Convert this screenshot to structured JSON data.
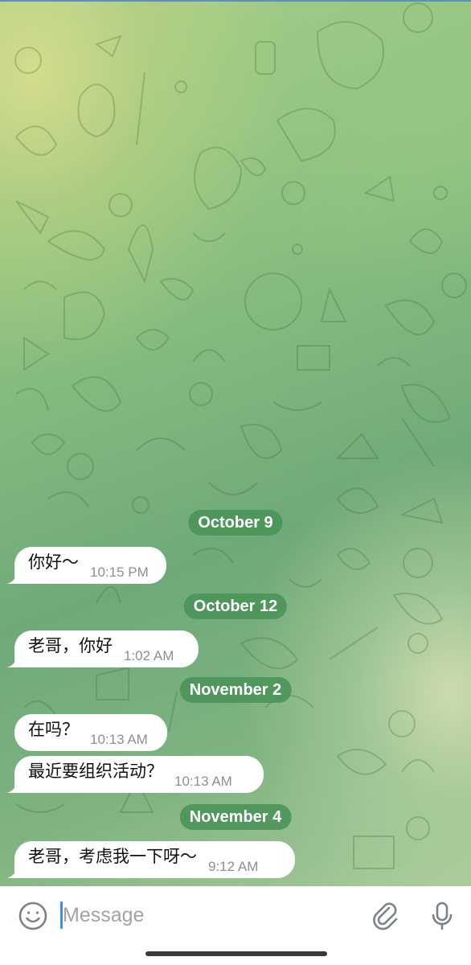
{
  "chat": {
    "dates": {
      "d1": "October 9",
      "d2": "October 12",
      "d3": "November 2",
      "d4": "November 4"
    },
    "messages": {
      "m1": {
        "text": "你好～",
        "time": "10:15 PM"
      },
      "m2": {
        "text": "老哥，你好",
        "time": "1:02 AM"
      },
      "m3": {
        "text": "在吗？",
        "time": "10:13 AM"
      },
      "m4": {
        "text": "最近要组织活动？",
        "time": "10:13 AM"
      },
      "m5": {
        "text": "老哥，考虑我一下呀～",
        "time": "9:12 AM"
      }
    }
  },
  "input_bar": {
    "placeholder": "Message",
    "value": "",
    "emoji_icon": "emoji-icon",
    "attach_icon": "paperclip-icon",
    "mic_icon": "microphone-icon"
  },
  "colors": {
    "date_pill": "#469155",
    "bubble": "#ffffff",
    "accent_caret": "#3f8ee8",
    "time_text": "#8b9097"
  }
}
